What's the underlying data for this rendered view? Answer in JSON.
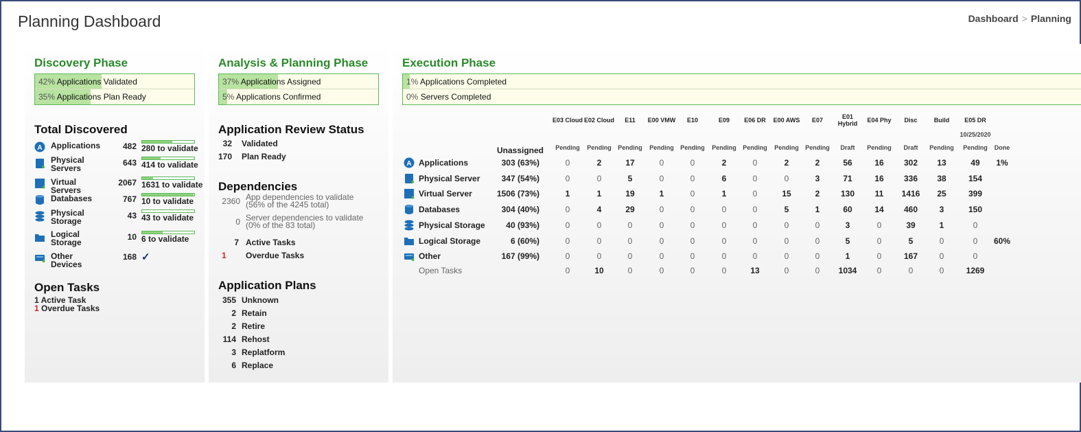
{
  "header": {
    "title": "Planning Dashboard",
    "breadcrumb": [
      "Dashboard",
      "Planning"
    ],
    "breadcrumb_sep": ">"
  },
  "discovery": {
    "title": "Discovery Phase",
    "progress": [
      {
        "pct": "42%",
        "label": "Applications Validated",
        "fraction": 0.42
      },
      {
        "pct": "35%",
        "label": "Applications Plan Ready",
        "fraction": 0.35
      }
    ],
    "total_title": "Total Discovered",
    "items": [
      {
        "label": "Applications",
        "count": "482",
        "validate": "280 to validate",
        "fraction": 0.58,
        "icon": "app-icon"
      },
      {
        "label": "Physical Servers",
        "count": "643",
        "validate": "414 to validate",
        "fraction": 0.36,
        "icon": "physical-server-icon"
      },
      {
        "label": "Virtual Servers",
        "count": "2067",
        "validate": "1631 to validate",
        "fraction": 0.21,
        "icon": "virtual-server-icon"
      },
      {
        "label": "Databases",
        "count": "767",
        "validate": "10 to validate",
        "fraction": 0.99,
        "icon": "database-icon"
      },
      {
        "label": "Physical Storage",
        "count": "43",
        "validate": "43 to validate",
        "fraction": 0.0,
        "icon": "physical-storage-icon"
      },
      {
        "label": "Logical Storage",
        "count": "10",
        "validate": "6 to validate",
        "fraction": 0.4,
        "icon": "logical-storage-icon"
      },
      {
        "label": "Other Devices",
        "count": "168",
        "validate": "✓",
        "icon": "other-device-icon"
      }
    ],
    "open_tasks_title": "Open Tasks",
    "open_tasks": {
      "active": "1 Active Task",
      "overdue_num": "1",
      "overdue_label": "Overdue Tasks"
    }
  },
  "analysis": {
    "title": "Analysis & Planning Phase",
    "progress": [
      {
        "pct": "37%",
        "label": "Applications Assigned",
        "fraction": 0.37
      },
      {
        "pct": "5%",
        "label": "Applications Confirmed",
        "fraction": 0.05
      }
    ],
    "review_title": "Application Review Status",
    "review": [
      {
        "count": "32",
        "label": "Validated"
      },
      {
        "count": "170",
        "label": "Plan Ready"
      }
    ],
    "deps_title": "Dependencies",
    "deps": [
      {
        "count": "2360",
        "line1": "App dependencies to validate",
        "line2": "(56% of the 4245 total)"
      },
      {
        "count": "0",
        "line1": "Server dependencies to validate",
        "line2": "(0% of the 83 total)"
      }
    ],
    "tasks": [
      {
        "count": "7",
        "label": "Active Tasks"
      },
      {
        "count": "1",
        "label": "Overdue Tasks"
      }
    ],
    "plans_title": "Application Plans",
    "plans": [
      {
        "count": "355",
        "label": "Unknown"
      },
      {
        "count": "2",
        "label": "Retain"
      },
      {
        "count": "2",
        "label": "Retire"
      },
      {
        "count": "114",
        "label": "Rehost"
      },
      {
        "count": "3",
        "label": "Replatform"
      },
      {
        "count": "6",
        "label": "Replace"
      }
    ]
  },
  "execution": {
    "title": "Execution Phase",
    "progress": [
      {
        "pct": "1%",
        "label": "Applications Completed",
        "fraction": 0.01
      },
      {
        "pct": "0%",
        "label": "Servers Completed",
        "fraction": 0.0
      }
    ],
    "unassigned_label": "Unassigned",
    "events": [
      {
        "name": "E03 Cloud",
        "status": "Pending"
      },
      {
        "name": "E02 Cloud",
        "status": "Pending"
      },
      {
        "name": "E11",
        "status": "Pending"
      },
      {
        "name": "E00 VMW",
        "status": "Pending"
      },
      {
        "name": "E10",
        "status": "Pending"
      },
      {
        "name": "E09",
        "status": "Pending"
      },
      {
        "name": "E06 DR",
        "status": "Pending"
      },
      {
        "name": "E00 AWS",
        "status": "Pending"
      },
      {
        "name": "E07",
        "status": "Pending"
      },
      {
        "name": "E01 Hybrid",
        "status": "Draft"
      },
      {
        "name": "E04 Phy",
        "status": "Pending"
      },
      {
        "name": "Disc",
        "status": "Draft"
      },
      {
        "name": "Build",
        "status": "Pending"
      },
      {
        "name": "E05 DR",
        "date": "10/25/2020",
        "status": "Pending"
      },
      {
        "name": "",
        "status": "Done"
      }
    ],
    "rows": [
      {
        "label": "Applications",
        "icon": "app-icon",
        "unassigned": "303 (63%)",
        "values": [
          "0",
          "2",
          "17",
          "0",
          "0",
          "2",
          "0",
          "2",
          "2",
          "56",
          "16",
          "302",
          "13",
          "49",
          "1%"
        ]
      },
      {
        "label": "Physical Server",
        "icon": "physical-server-icon",
        "unassigned": "347 (54%)",
        "values": [
          "0",
          "0",
          "5",
          "0",
          "0",
          "6",
          "0",
          "0",
          "3",
          "71",
          "16",
          "336",
          "38",
          "154",
          ""
        ]
      },
      {
        "label": "Virtual Server",
        "icon": "virtual-server-icon",
        "unassigned": "1506 (73%)",
        "values": [
          "1",
          "1",
          "19",
          "1",
          "0",
          "1",
          "0",
          "15",
          "2",
          "130",
          "11",
          "1416",
          "25",
          "399",
          ""
        ]
      },
      {
        "label": "Databases",
        "icon": "database-icon",
        "unassigned": "304 (40%)",
        "values": [
          "0",
          "4",
          "29",
          "0",
          "0",
          "0",
          "0",
          "5",
          "1",
          "60",
          "14",
          "460",
          "3",
          "150",
          ""
        ]
      },
      {
        "label": "Physical Storage",
        "icon": "physical-storage-icon",
        "unassigned": "40 (93%)",
        "values": [
          "0",
          "0",
          "0",
          "0",
          "0",
          "0",
          "0",
          "0",
          "0",
          "3",
          "0",
          "39",
          "1",
          "0",
          ""
        ]
      },
      {
        "label": "Logical Storage",
        "icon": "logical-storage-icon",
        "unassigned": "6 (60%)",
        "values": [
          "0",
          "0",
          "0",
          "0",
          "0",
          "0",
          "0",
          "0",
          "0",
          "5",
          "0",
          "5",
          "0",
          "0",
          "60%"
        ]
      },
      {
        "label": "Other",
        "icon": "other-device-icon",
        "unassigned": "167 (99%)",
        "values": [
          "0",
          "0",
          "0",
          "0",
          "0",
          "0",
          "0",
          "0",
          "0",
          "1",
          "0",
          "167",
          "0",
          "0",
          ""
        ]
      }
    ],
    "open_tasks": {
      "label": "Open Tasks",
      "values": [
        "0",
        "10",
        "0",
        "0",
        "0",
        "0",
        "13",
        "0",
        "0",
        "1034",
        "0",
        "0",
        "0",
        "1269",
        ""
      ]
    }
  },
  "colors": {
    "phase_title": "#2a8a2a",
    "progress_fill": "#b8e3a0",
    "icon_blue": "#1e6fb8",
    "overdue": "#d9231e"
  }
}
